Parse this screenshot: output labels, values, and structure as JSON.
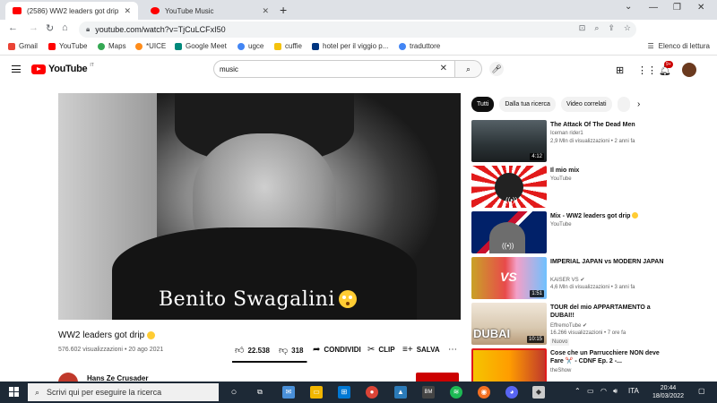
{
  "browser": {
    "tabs": [
      {
        "title": "(2586) WW2 leaders got drip",
        "active": true
      },
      {
        "title": "YouTube Music",
        "active": false
      }
    ],
    "url": "youtube.com/watch?v=TjCuLCFxI50",
    "bookmarks": [
      "Gmail",
      "YouTube",
      "Maps",
      "*UICE",
      "Google Meet",
      "ugce",
      "cuffie",
      "hotel per il viggio p...",
      "traduttore"
    ],
    "reading_list": "Elenco di lettura"
  },
  "youtube": {
    "search_query": "music",
    "notification_count": "9+",
    "video": {
      "caption": "Benito Swagalini",
      "title": "WW2 leaders got drip",
      "views": "576.602 visualizzazioni",
      "date": "20 ago 2021",
      "likes": "22.538",
      "dislikes": "318",
      "share": "CONDIVIDI",
      "clip": "CLIP",
      "save": "SALVA",
      "channel": "Hans Ze Crusader",
      "like_ratio": 0.986
    },
    "chips": [
      "Tutti",
      "Dalla tua ricerca",
      "Video correlati"
    ],
    "recommendations": [
      {
        "title": "The Attack Of The Dead Men",
        "channel": "Iceman rider1",
        "meta": "2,9 Mln di visualizzazioni • 2 anni fa",
        "duration": "4:12"
      },
      {
        "title": "Il mio mix",
        "channel": "YouTube",
        "meta": "",
        "duration": ""
      },
      {
        "title": "Mix - WW2 leaders got drip",
        "channel": "YouTube",
        "meta": "",
        "duration": ""
      },
      {
        "title": "IMPERIAL JAPAN vs MODERN JAPAN",
        "channel": "KAISER VS",
        "meta": "4,6 Mln di visualizzazioni • 3 anni fa",
        "duration": "1:51"
      },
      {
        "title": "TOUR del mio APPARTAMENTO a DUBAI!!",
        "channel": "EffremoTube",
        "meta": "16.266 visualizzazioni • 7 ore fa",
        "duration": "10:15",
        "badge": "Nuovo",
        "thumb_text": "DUBAI"
      },
      {
        "title": "Cose che un Parrucchiere NON deve Fare ✂️ - CDNF Ep. 2 -...",
        "channel": "theShow",
        "meta": "",
        "duration": ""
      }
    ]
  },
  "taskbar": {
    "search_placeholder": "Scrivi qui per eseguire la ricerca",
    "language": "ITA",
    "time": "20:44",
    "date": "18/03/2022"
  },
  "colors": {
    "youtube_red": "#ff0000",
    "taskbar": "#1d2936",
    "chip_active": "#0f0f0f"
  }
}
